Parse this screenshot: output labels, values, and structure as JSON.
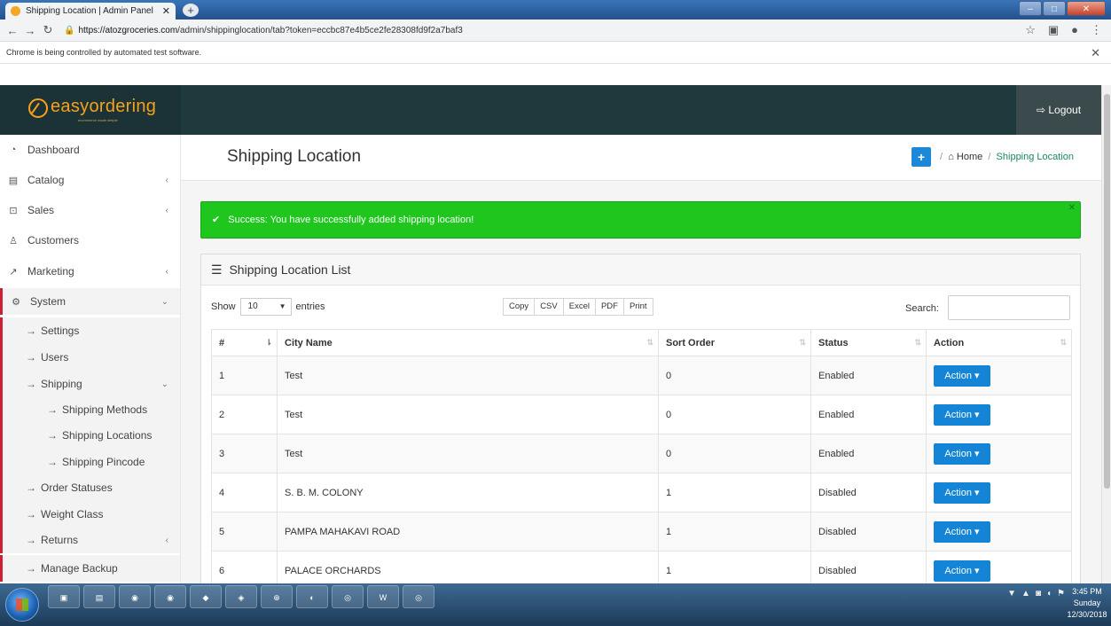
{
  "browser": {
    "tab_title": "Shipping Location | Admin Panel",
    "url_host": "https://atozgroceries.com",
    "url_path": "/admin/shippinglocation/tab?token=eccbc87e4b5ce2fe28308fd9f2a7baf3",
    "infobar_text": "Chrome is being controlled by automated test software."
  },
  "header": {
    "brand": "easyordering",
    "tagline": "ecommerce made simple",
    "logout_label": "Logout"
  },
  "sidebar": {
    "items": [
      {
        "label": "Dashboard"
      },
      {
        "label": "Catalog"
      },
      {
        "label": "Sales"
      },
      {
        "label": "Customers"
      },
      {
        "label": "Marketing"
      },
      {
        "label": "System"
      }
    ],
    "system_children": [
      {
        "label": "Settings"
      },
      {
        "label": "Users"
      },
      {
        "label": "Shipping"
      },
      {
        "label": "Shipping Methods"
      },
      {
        "label": "Shipping Locations"
      },
      {
        "label": "Shipping Pincode"
      },
      {
        "label": "Order Statuses"
      },
      {
        "label": "Weight Class"
      },
      {
        "label": "Returns"
      },
      {
        "label": "Manage Backup"
      }
    ]
  },
  "page": {
    "title": "Shipping Location",
    "breadcrumb_home": "Home",
    "breadcrumb_current": "Shipping Location",
    "alert_text": "Success: You have successfully added shipping location!",
    "panel_title": "Shipping Location List",
    "show_label": "Show",
    "entries_label": "entries",
    "entries_value": "10",
    "search_label": "Search:",
    "export_buttons": [
      "Copy",
      "CSV",
      "Excel",
      "PDF",
      "Print"
    ]
  },
  "table": {
    "columns": [
      "#",
      "City Name",
      "Sort Order",
      "Status",
      "Action"
    ],
    "action_label": "Action",
    "rows": [
      {
        "num": "1",
        "city": "Test",
        "sort": "0",
        "status": "Enabled"
      },
      {
        "num": "2",
        "city": "Test",
        "sort": "0",
        "status": "Enabled"
      },
      {
        "num": "3",
        "city": "Test",
        "sort": "0",
        "status": "Enabled"
      },
      {
        "num": "4",
        "city": "S. B. M. COLONY",
        "sort": "1",
        "status": "Disabled"
      },
      {
        "num": "5",
        "city": "PAMPA MAHAKAVI ROAD",
        "sort": "1",
        "status": "Disabled"
      },
      {
        "num": "6",
        "city": "PALACE ORCHARDS",
        "sort": "1",
        "status": "Disabled"
      }
    ]
  },
  "taskbar": {
    "time": "3:45 PM",
    "day": "Sunday",
    "date": "12/30/2018"
  },
  "colors": {
    "header_bg": "#1f3a3d",
    "brand_orange": "#f7a11a",
    "success_green": "#1ec61e",
    "action_blue": "#1384d6",
    "system_marker": "#cc1f36"
  }
}
